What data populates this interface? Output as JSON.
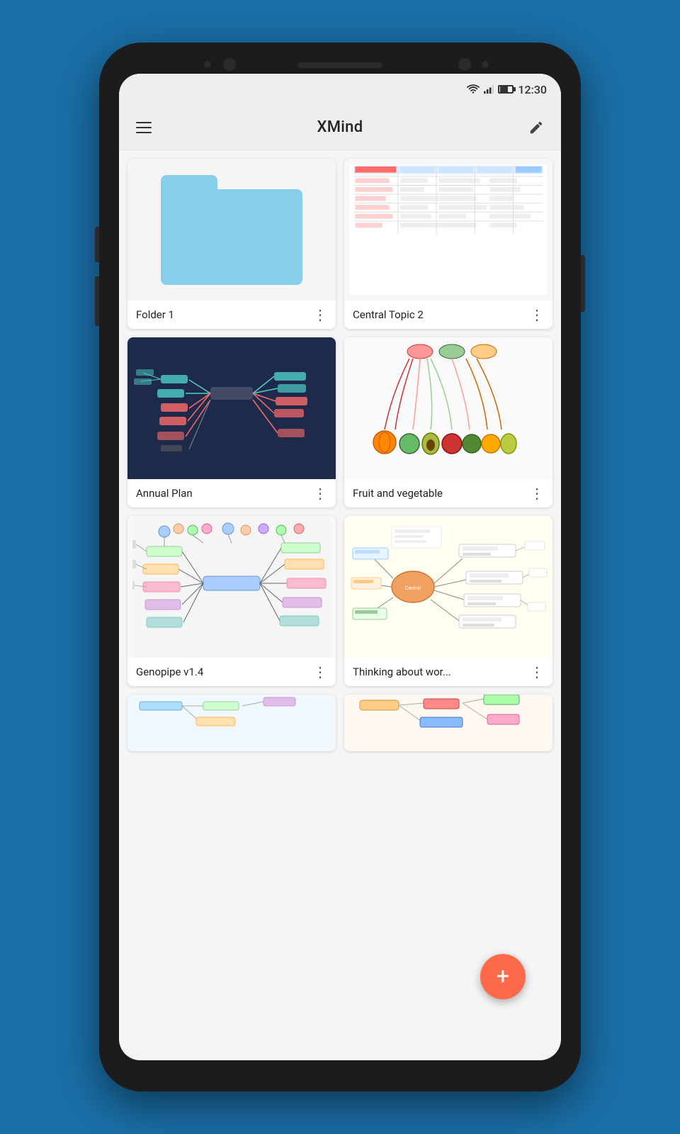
{
  "app": {
    "title": "XMind",
    "status_bar": {
      "time": "12:30"
    }
  },
  "cards": [
    {
      "id": "folder1",
      "title": "Folder 1",
      "type": "folder"
    },
    {
      "id": "central-topic-2",
      "title": "Central Topic 2",
      "type": "table-mindmap"
    },
    {
      "id": "annual-plan",
      "title": "Annual Plan",
      "type": "dark-mindmap"
    },
    {
      "id": "fruit-vegetable",
      "title": "Fruit and vegetable",
      "type": "fruit-mindmap"
    },
    {
      "id": "genopipe",
      "title": "Genopipe v1.4",
      "type": "genopipe-mindmap"
    },
    {
      "id": "thinking-about-wor",
      "title": "Thinking about wor...",
      "type": "thinking-mindmap"
    },
    {
      "id": "bottom-left",
      "title": "",
      "type": "partial"
    },
    {
      "id": "bottom-right",
      "title": "",
      "type": "partial-blue"
    }
  ],
  "fab": {
    "label": "+"
  }
}
